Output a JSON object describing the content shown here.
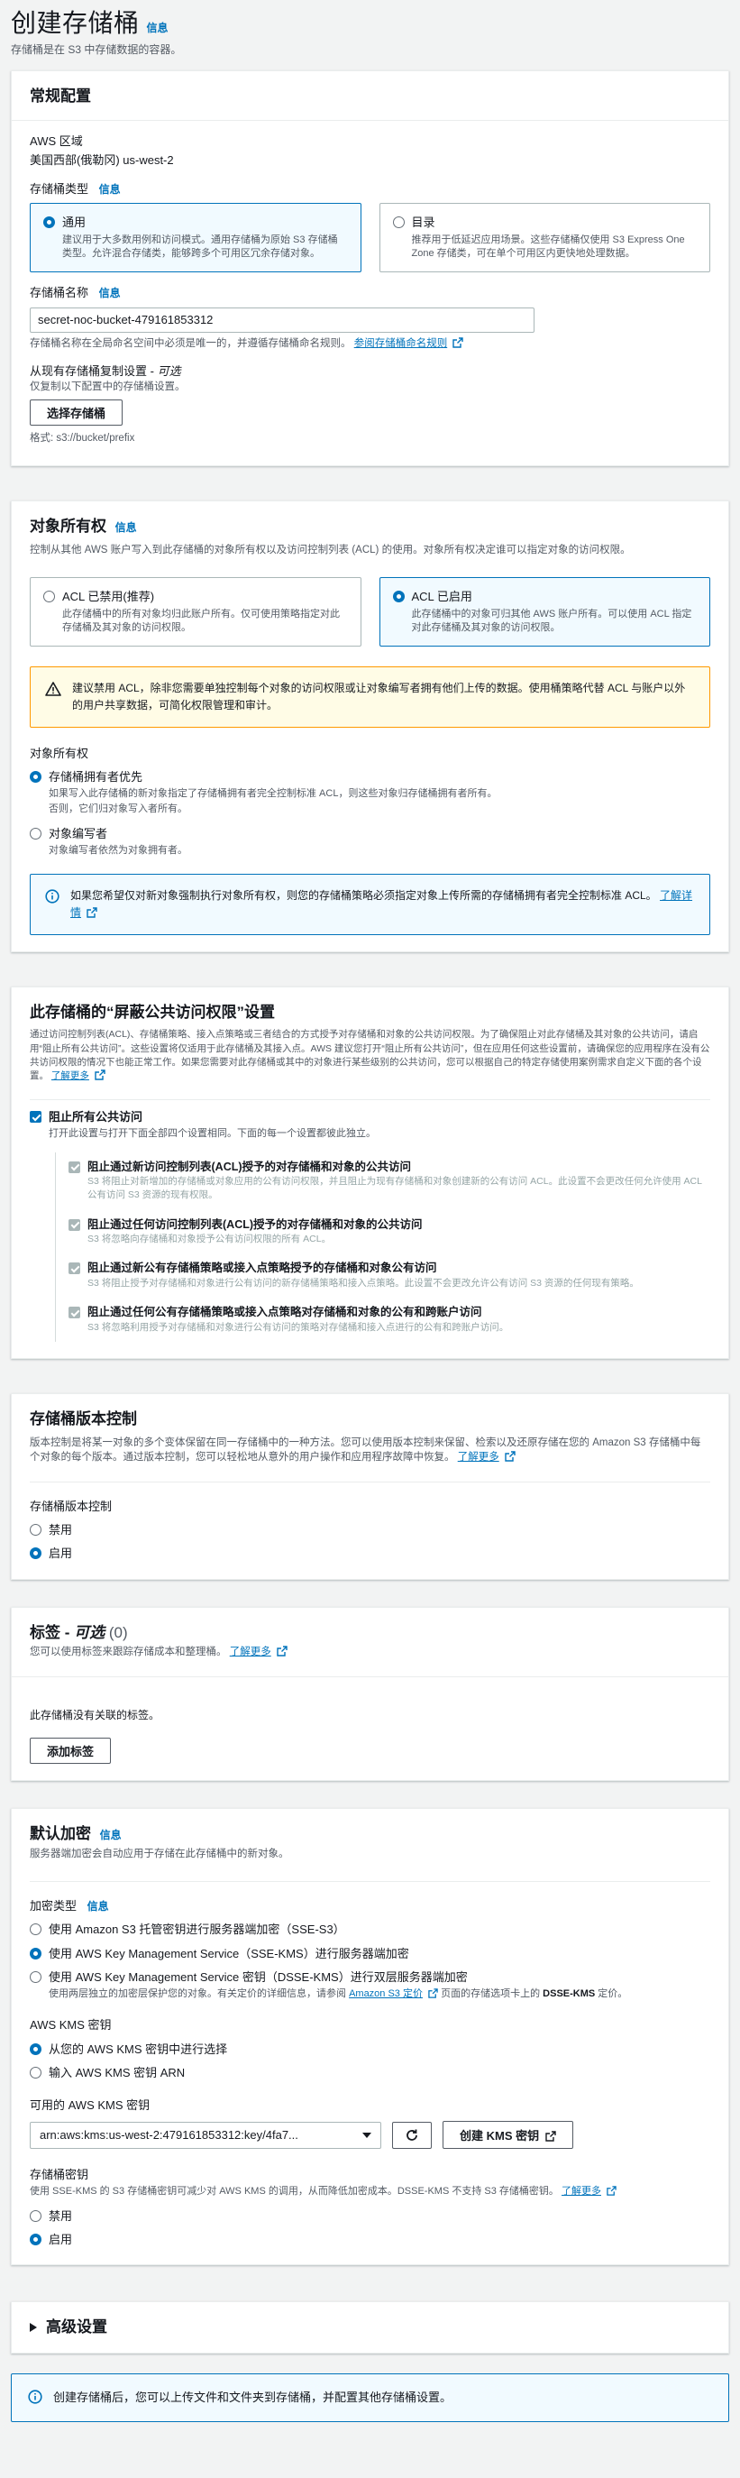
{
  "page": {
    "title": "创建存储桶",
    "info": "信息",
    "subtitle": "存储桶是在 S3 中存储数据的容器。"
  },
  "general": {
    "title": "常规配置",
    "region_label": "AWS 区域",
    "region_value": "美国西部(俄勒冈) us-west-2",
    "type_label": "存储桶类型",
    "type_info": "信息",
    "type_general_title": "通用",
    "type_general_desc": "建议用于大多数用例和访问模式。通用存储桶为原始 S3 存储桶类型。允许混合存储类，能够跨多个可用区冗余存储对象。",
    "type_directory_title": "目录",
    "type_directory_desc": "推荐用于低延迟应用场景。这些存储桶仅使用 S3 Express One Zone 存储类，可在单个可用区内更快地处理数据。",
    "name_label": "存储桶名称",
    "name_info": "信息",
    "name_value": "secret-noc-bucket-479161853312",
    "name_help": "存储桶名称在全局命名空间中必须是唯一的，并遵循存储桶命名规则。",
    "name_rules_link": "参阅存储桶命名规则",
    "copy_label": "从现有存储桶复制设置",
    "copy_optional": "可选",
    "copy_help": "仅复制以下配置中的存储桶设置。",
    "copy_button": "选择存储桶",
    "copy_format": "格式: s3://bucket/prefix"
  },
  "ownership": {
    "title": "对象所有权",
    "desc": "控制从其他 AWS 账户写入到此存储桶的对象所有权以及访问控制列表 (ACL) 的使用。对象所有权决定谁可以指定对象的访问权限。",
    "acl_disabled_title": "ACL 已禁用(推荐)",
    "acl_disabled_desc": "此存储桶中的所有对象均归此账户所有。仅可使用策略指定对此存储桶及其对象的访问权限。",
    "acl_enabled_title": "ACL 已启用",
    "acl_enabled_desc": "此存储桶中的对象可归其他 AWS 账户所有。可以使用 ACL 指定对此存储桶及其对象的访问权限。",
    "warning": "建议禁用 ACL，除非您需要单独控制每个对象的访问权限或让对象编写者拥有他们上传的数据。使用桶策略代替 ACL 与账户以外的用户共享数据，可简化权限管理和审计。",
    "owner_label": "对象所有权",
    "opt1_title": "存储桶拥有者优先",
    "opt1_desc1": "如果写入此存储桶的新对象指定了存储桶拥有者完全控制标准 ACL，则这些对象归存储桶拥有者所有。",
    "opt1_desc2": "否则，它们归对象写入者所有。",
    "opt2_title": "对象编写者",
    "opt2_desc": "对象编写者依然为对象拥有者。",
    "info_alert": "如果您希望仅对新对象强制执行对象所有权，则您的存储桶策略必须指定对象上传所需的存储桶拥有者完全控制标准 ACL。",
    "info_link": "了解详情"
  },
  "public_access": {
    "title": "此存储桶的“屏蔽公共访问权限”设置",
    "desc": "通过访问控制列表(ACL)、存储桶策略、接入点策略或三者结合的方式授予对存储桶和对象的公共访问权限。为了确保阻止对此存储桶及其对象的公共访问，请启用“阻止所有公共访问”。这些设置将仅适用于此存储桶及其接入点。AWS 建议您打开“阻止所有公共访问”，但在应用任何这些设置前，请确保您的应用程序在没有公共访问权限的情况下也能正常工作。如果您需要对此存储桶或其中的对象进行某些级别的公共访问，您可以根据自己的特定存储使用案例需求自定义下面的各个设置。",
    "learn_more": "了解更多",
    "block_all_title": "阻止所有公共访问",
    "block_all_desc": "打开此设置与打开下面全部四个设置相同。下面的每一个设置都彼此独立。",
    "items": [
      {
        "title": "阻止通过新访问控制列表(ACL)授予的对存储桶和对象的公共访问",
        "desc": "S3 将阻止对新增加的存储桶或对象应用的公有访问权限，并且阻止为现有存储桶和对象创建新的公有访问 ACL。此设置不会更改任何允许使用 ACL 公有访问 S3 资源的现有权限。"
      },
      {
        "title": "阻止通过任何访问控制列表(ACL)授予的对存储桶和对象的公共访问",
        "desc": "S3 将忽略向存储桶和对象授予公有访问权限的所有 ACL。"
      },
      {
        "title": "阻止通过新公有存储桶策略或接入点策略授予的存储桶和对象公有访问",
        "desc": "S3 将阻止授予对存储桶和对象进行公有访问的新存储桶策略和接入点策略。此设置不会更改允许公有访问 S3 资源的任何现有策略。"
      },
      {
        "title": "阻止通过任何公有存储桶策略或接入点策略对存储桶和对象的公有和跨账户访问",
        "desc": "S3 将忽略利用授予对存储桶和对象进行公有访问的策略对存储桶和接入点进行的公有和跨账户访问。"
      }
    ]
  },
  "versioning": {
    "title": "存储桶版本控制",
    "desc": "版本控制是将某一对象的多个变体保留在同一存储桶中的一种方法。您可以使用版本控制来保留、检索以及还原存储在您的 Amazon S3 存储桶中每个对象的每个版本。通过版本控制，您可以轻松地从意外的用户操作和应用程序故障中恢复。",
    "learn_more": "了解更多",
    "label": "存储桶版本控制",
    "opt_disable": "禁用",
    "opt_enable": "启用"
  },
  "tags": {
    "title": "标签",
    "optional": "可选",
    "count": "(0)",
    "desc": "您可以使用标签来跟踪存储成本和整理桶。",
    "learn_more": "了解更多",
    "empty": "此存储桶没有关联的标签。",
    "add_button": "添加标签"
  },
  "encryption": {
    "title": "默认加密",
    "info": "信息",
    "desc": "服务器端加密会自动应用于存储在此存储桶中的新对象。",
    "type_label": "加密类型",
    "type_info": "信息",
    "opt1": "使用 Amazon S3 托管密钥进行服务器端加密（SSE-S3）",
    "opt2": "使用 AWS Key Management Service（SSE-KMS）进行服务器端加密",
    "opt3": "使用 AWS Key Management Service 密钥（DSSE-KMS）进行双层服务器端加密",
    "opt3_desc_a": "使用两层独立的加密层保护您的对象。有关定价的详细信息，请参阅",
    "opt3_link": "Amazon S3 定价",
    "opt3_desc_b": "页面的存储选项卡上的",
    "opt3_desc_bold": "DSSE-KMS",
    "opt3_desc_c": "定价。",
    "kms_label": "AWS KMS 密钥",
    "kms_opt1": "从您的 AWS KMS 密钥中进行选择",
    "kms_opt2": "输入 AWS KMS 密钥 ARN",
    "kms_avail_label": "可用的 AWS KMS 密钥",
    "kms_select_value": "arn:aws:kms:us-west-2:479161853312:key/4fa7...",
    "create_key_button": "创建 KMS 密钥",
    "bucket_key_label": "存储桶密钥",
    "bucket_key_desc": "使用 SSE-KMS 的 S3 存储桶密钥可减少对 AWS KMS 的调用，从而降低加密成本。DSSE-KMS 不支持 S3 存储桶密钥。",
    "bucket_key_learn": "了解更多",
    "bk_opt_disable": "禁用",
    "bk_opt_enable": "启用"
  },
  "advanced": {
    "title": "高级设置"
  },
  "footer": {
    "info": "创建存储桶后，您可以上传文件和文件夹到存储桶，并配置其他存储桶设置。"
  },
  "colors": {
    "accent": "#0073bb",
    "warning": "#ff9900",
    "text": "#16191f"
  }
}
